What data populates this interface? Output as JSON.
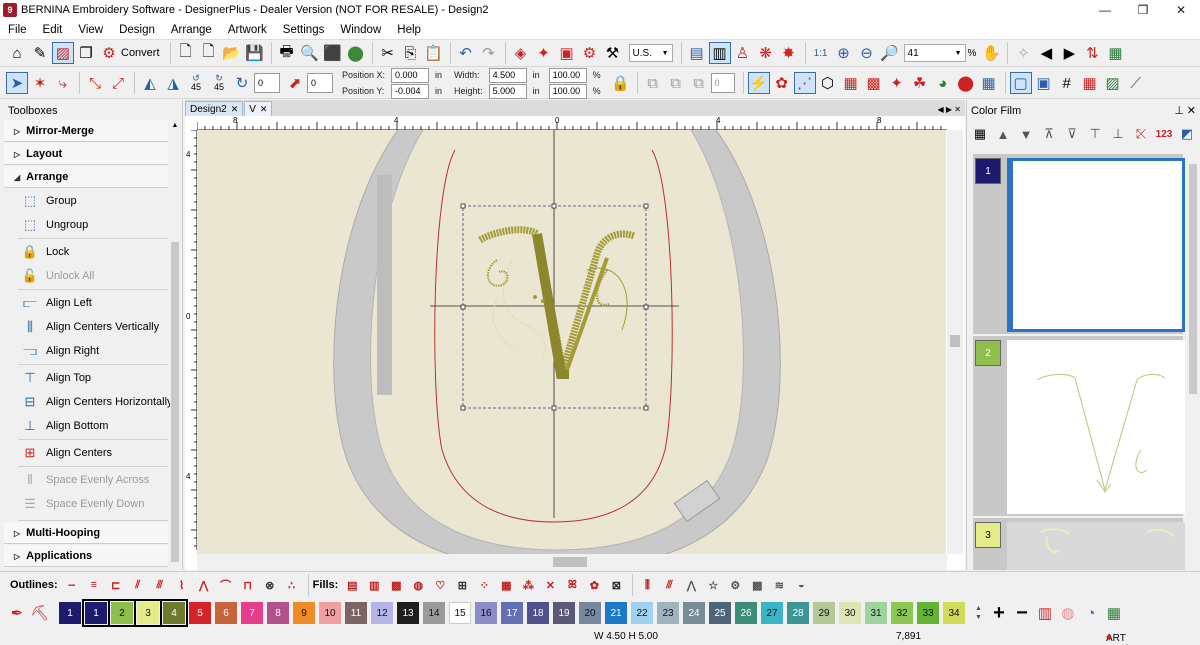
{
  "app": {
    "title": "BERNINA Embroidery Software - DesignerPlus - Dealer Version (NOT FOR RESALE) - Design2",
    "icon_letter": "9"
  },
  "window_controls": {
    "minimize": "—",
    "maximize": "❐",
    "close": "✕"
  },
  "menu": [
    "File",
    "Edit",
    "View",
    "Design",
    "Arrange",
    "Artwork",
    "Settings",
    "Window",
    "Help"
  ],
  "toolbar1": {
    "convert_label": "Convert",
    "units_value": "U.S.",
    "zoom_value": "41",
    "zoom_unit": "%"
  },
  "toolbar2": {
    "rotate_ccw_label": "45",
    "rotate_cw_label": "45",
    "rotate_value": "0",
    "skew_value": "0",
    "position_x_label": "Position X:",
    "position_x_value": "0.000",
    "position_x_unit": "in",
    "position_y_label": "Position Y:",
    "position_y_value": "-0.004",
    "position_y_unit": "in",
    "width_label": "Width:",
    "width_value": "4.500",
    "width_unit": "in",
    "height_label": "Height:",
    "height_value": "5.000",
    "height_unit": "in",
    "width_pct": "100.00",
    "height_pct": "100.00",
    "pct_unit": "%",
    "stack_value": "0"
  },
  "toolboxes": {
    "header": "Toolboxes",
    "sections_top": [
      "Mirror-Merge",
      "Layout"
    ],
    "arrange_section": "Arrange",
    "commands": [
      {
        "label": "Group",
        "icon": "group-icon",
        "enabled": true
      },
      {
        "label": "Ungroup",
        "icon": "ungroup-icon",
        "enabled": true
      },
      {
        "label": "Lock",
        "icon": "lock-icon",
        "enabled": true
      },
      {
        "label": "Unlock All",
        "icon": "unlock-icon",
        "enabled": false
      },
      {
        "label": "Align Left",
        "icon": "align-left-icon",
        "enabled": true
      },
      {
        "label": "Align Centers Vertically",
        "icon": "align-centers-vertically-icon",
        "enabled": true
      },
      {
        "label": "Align Right",
        "icon": "align-right-icon",
        "enabled": true
      },
      {
        "label": "Align Top",
        "icon": "align-top-icon",
        "enabled": true
      },
      {
        "label": "Align Centers Horizontally",
        "icon": "align-centers-horizontally-icon",
        "enabled": true
      },
      {
        "label": "Align Bottom",
        "icon": "align-bottom-icon",
        "enabled": true
      },
      {
        "label": "Align Centers",
        "icon": "align-centers-icon",
        "enabled": true
      },
      {
        "label": "Space Evenly Across",
        "icon": "space-evenly-across-icon",
        "enabled": false
      },
      {
        "label": "Space Evenly Down",
        "icon": "space-evenly-down-icon",
        "enabled": false
      }
    ],
    "sections_bottom": [
      "Multi-Hooping",
      "Applications"
    ]
  },
  "tabs": [
    {
      "label": "Design2",
      "close": "✕"
    },
    {
      "label": "V",
      "close": "✕"
    }
  ],
  "rulers": {
    "h_ticks": [
      "8",
      "4",
      "0",
      "4",
      "8"
    ],
    "v_ticks": [
      "4",
      "0",
      "4"
    ]
  },
  "color_film": {
    "header": "Color Film",
    "pin": "⊥",
    "close": "✕",
    "items": [
      {
        "number": "1",
        "color": "#1e1a6e"
      },
      {
        "number": "2",
        "color": "#8fbf4a"
      },
      {
        "number": "3",
        "color": "#e4ec8a"
      }
    ],
    "sequence_label": "123"
  },
  "bottom": {
    "outlines_label": "Outlines:",
    "fills_label": "Fills:"
  },
  "palette": [
    {
      "n": "1",
      "c": "#1e1a6e"
    },
    {
      "n": "1",
      "c": "#1e1a6e",
      "sel": true
    },
    {
      "n": "2",
      "c": "#8fbf4a",
      "sel": true
    },
    {
      "n": "3",
      "c": "#e4ec8a",
      "sel": true
    },
    {
      "n": "4",
      "c": "#6f7a2a",
      "sel": true
    },
    {
      "n": "5",
      "c": "#d42429"
    },
    {
      "n": "6",
      "c": "#c8643c"
    },
    {
      "n": "7",
      "c": "#e63c8c"
    },
    {
      "n": "8",
      "c": "#b4508c"
    },
    {
      "n": "9",
      "c": "#f08c28"
    },
    {
      "n": "10",
      "c": "#f0a0a0"
    },
    {
      "n": "11",
      "c": "#7c6464"
    },
    {
      "n": "12",
      "c": "#b4b4e6"
    },
    {
      "n": "13",
      "c": "#1e1e1e"
    },
    {
      "n": "14",
      "c": "#9a9a9a"
    },
    {
      "n": "15",
      "c": "#ffffff"
    },
    {
      "n": "16",
      "c": "#8c8cc8"
    },
    {
      "n": "17",
      "c": "#6470b4"
    },
    {
      "n": "18",
      "c": "#50508c"
    },
    {
      "n": "19",
      "c": "#5a5a78"
    },
    {
      "n": "20",
      "c": "#7888a0"
    },
    {
      "n": "21",
      "c": "#1e78c8"
    },
    {
      "n": "22",
      "c": "#a0d2f0"
    },
    {
      "n": "23",
      "c": "#a0b4c0"
    },
    {
      "n": "24",
      "c": "#788c96"
    },
    {
      "n": "25",
      "c": "#506478"
    },
    {
      "n": "26",
      "c": "#3c8c78"
    },
    {
      "n": "27",
      "c": "#3cb4c8"
    },
    {
      "n": "28",
      "c": "#3c9694"
    },
    {
      "n": "29",
      "c": "#b4c896"
    },
    {
      "n": "30",
      "c": "#dce6b4"
    },
    {
      "n": "31",
      "c": "#a0d2a0"
    },
    {
      "n": "32",
      "c": "#8cc850"
    },
    {
      "n": "33",
      "c": "#64b432"
    },
    {
      "n": "34",
      "c": "#d2dc5a"
    }
  ],
  "status": {
    "size": "W 4.50 H 5.00",
    "stitches": "7,891",
    "art_grade": "ART Grade: A",
    "heart": "♥"
  }
}
